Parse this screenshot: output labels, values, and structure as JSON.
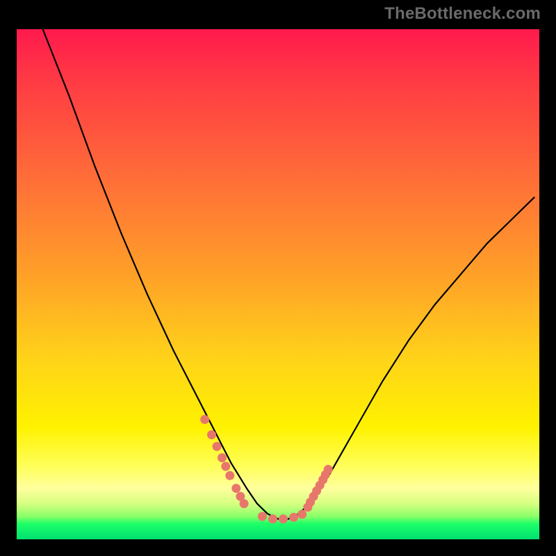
{
  "watermark": "TheBottleneck.com",
  "colors": {
    "curve": "#000000",
    "marker": "#e8776b",
    "background": "#000000"
  },
  "chart_data": {
    "type": "line",
    "title": "",
    "xlabel": "",
    "ylabel": "",
    "xlim": [
      0,
      100
    ],
    "ylim": [
      0,
      100
    ],
    "grid": false,
    "legend": false,
    "note": "Axes are unlabeled in the source image; x/y values are read off by proportional position (0–100 each). y=0 is the bottom of the plot, x=0 is the left edge.",
    "series": [
      {
        "name": "bottleneck-curve",
        "x": [
          5,
          10,
          15,
          20,
          25,
          30,
          35,
          38,
          41,
          44,
          46,
          48,
          50,
          52,
          54,
          57,
          60,
          65,
          70,
          75,
          80,
          85,
          90,
          95,
          99
        ],
        "y": [
          100,
          87,
          73,
          60,
          48,
          37,
          27,
          21,
          15,
          10,
          7,
          5,
          4,
          4,
          5,
          8,
          13,
          22,
          31,
          39,
          46,
          52,
          58,
          63,
          67
        ]
      }
    ],
    "markers": [
      {
        "name": "left-cluster",
        "x": [
          36.0,
          37.3,
          38.3,
          39.3,
          40.0,
          40.8,
          42.0,
          42.8,
          43.5
        ],
        "y": [
          23.5,
          20.5,
          18.2,
          16.0,
          14.3,
          12.5,
          10.0,
          8.4,
          7.0
        ]
      },
      {
        "name": "bottom-cluster",
        "x": [
          47.0,
          49.0,
          51.0,
          53.0,
          54.6
        ],
        "y": [
          4.5,
          4.0,
          4.0,
          4.3,
          4.9
        ]
      },
      {
        "name": "right-cluster",
        "x": [
          55.7,
          56.2,
          56.8,
          57.4,
          58.0,
          58.6,
          59.1,
          59.6
        ],
        "y": [
          6.3,
          7.3,
          8.4,
          9.5,
          10.6,
          11.7,
          12.7,
          13.7
        ]
      }
    ]
  }
}
